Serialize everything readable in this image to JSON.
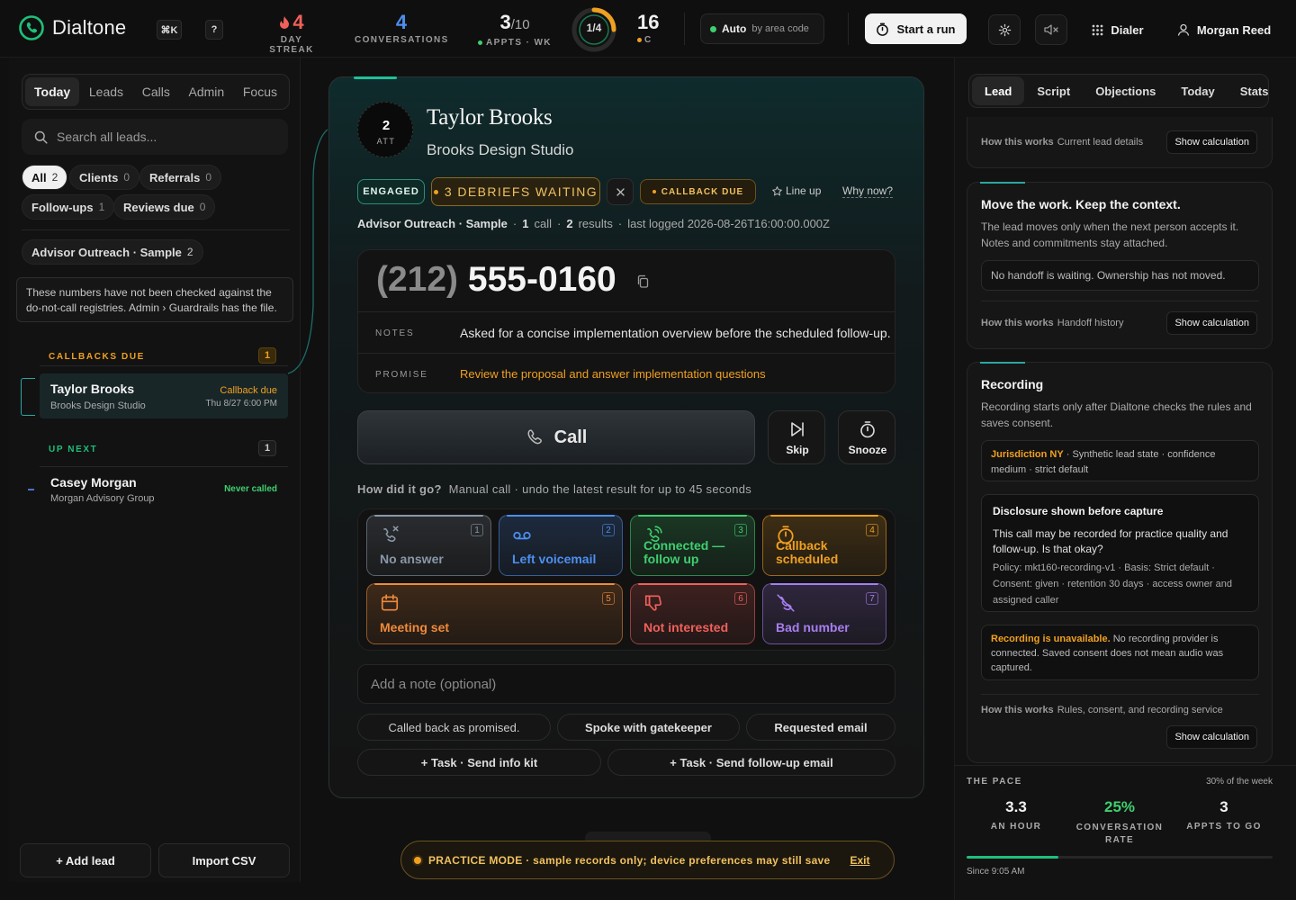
{
  "app": {
    "name": "Dialtone",
    "accent": "#1fbf7a"
  },
  "topbar": {
    "kbd_search": "⌘K",
    "kbd_help": "?",
    "streak": {
      "value": "4",
      "label": "DAY STREAK"
    },
    "conversations": {
      "value": "4",
      "label": "CONVERSATIONS"
    },
    "appts": {
      "value": "3",
      "total": "/10",
      "label": "APPTS · WK"
    },
    "ring": {
      "label": "1/4",
      "fraction": 0.25
    },
    "extra": {
      "value": "16",
      "label": "C"
    },
    "auto": {
      "label": "Auto",
      "sub": "by area code"
    },
    "start_run": "Start a run",
    "dialer": "Dialer",
    "user": "Morgan Reed"
  },
  "left": {
    "tabs": [
      "Today",
      "Leads",
      "Calls",
      "Admin",
      "Focus"
    ],
    "search_placeholder": "Search all leads...",
    "filters": [
      {
        "label": "All",
        "count": "2"
      },
      {
        "label": "Clients",
        "count": "0"
      },
      {
        "label": "Referrals",
        "count": "0"
      },
      {
        "label": "Follow-ups",
        "count": "1"
      },
      {
        "label": "Reviews due",
        "count": "0"
      }
    ],
    "campaign": {
      "label": "Advisor Outreach · Sample",
      "count": "2"
    },
    "warning": "These numbers have not been checked against the do-not-call registries. Admin › Guardrails has the file.",
    "callbacks": {
      "title": "CALLBACKS DUE",
      "count": "1",
      "item": {
        "name": "Taylor Brooks",
        "company": "Brooks Design Studio",
        "status": "Callback due",
        "time": "Thu 8/27 6:00 PM"
      }
    },
    "upnext": {
      "title": "UP NEXT",
      "count": "1",
      "item": {
        "name": "Casey Morgan",
        "company": "Morgan Advisory Group",
        "status": "Never called"
      }
    },
    "add_lead": "+ Add lead",
    "import_csv": "Import CSV"
  },
  "lead": {
    "attempts": "2",
    "attempts_label": "ATT",
    "name": "Taylor Brooks",
    "company": "Brooks Design Studio",
    "tag_engaged": "ENGAGED",
    "tag_debriefs": "3 DEBRIEFS WAITING",
    "tag_callback": "CALLBACK DUE",
    "line_up": "Line up",
    "why_now": "Why now?",
    "meta": {
      "campaign": "Advisor Outreach · Sample",
      "calls": "1",
      "calls_label": "call",
      "results": "2",
      "results_label": "results",
      "last": "last logged 2026-08-26T16:00:00.000Z"
    },
    "phone_area": "(212)",
    "phone_rest": "555-0160",
    "notes_label": "NOTES",
    "notes": "Asked for a concise implementation overview before the scheduled follow-up.",
    "promise_label": "PROMISE",
    "promise": "Review the proposal and answer implementation questions",
    "call_btn": "Call",
    "skip_btn": "Skip",
    "snooze_btn": "Snooze",
    "how_q": "How did it go?",
    "how_sub": "Manual call · undo the latest result for up to 45 seconds",
    "outcomes": [
      {
        "label": "No answer",
        "key": "1",
        "color": "#8a97a8"
      },
      {
        "label": "Left voicemail",
        "key": "2",
        "color": "#4c8ff0"
      },
      {
        "label": "Connected — follow up",
        "key": "3",
        "color": "#3fcf6f"
      },
      {
        "label": "Callback scheduled",
        "key": "4",
        "color": "#f0a020"
      },
      {
        "label": "Meeting set",
        "key": "5",
        "color": "#f08a3a"
      },
      {
        "label": "Not interested",
        "key": "6",
        "color": "#f0605a"
      },
      {
        "label": "Bad number",
        "key": "7",
        "color": "#a77ef0"
      }
    ],
    "note_placeholder": "Add a note (optional)",
    "quick": [
      "Called back as promised.",
      "Spoke with gatekeeper",
      "Requested email"
    ],
    "tasks": [
      "+ Task · Send info kit",
      "+ Task · Send follow-up email"
    ]
  },
  "practice": {
    "text": "PRACTICE MODE · sample records only; device preferences may still save",
    "exit": "Exit"
  },
  "right": {
    "tabs": [
      "Lead",
      "Script",
      "Objections",
      "Today",
      "Stats"
    ],
    "card0": {
      "hiw": "How this works",
      "hiw_sub": "Current lead details",
      "btn": "Show calculation"
    },
    "handoff": {
      "title": "Move the work. Keep the context.",
      "body": "The lead moves only when the next person accepts it. Notes and commitments stay attached.",
      "status": "No handoff is waiting. Ownership has not moved.",
      "hiw": "How this works",
      "hiw_sub": "Handoff history",
      "btn": "Show calculation"
    },
    "recording": {
      "title": "Recording",
      "body": "Recording starts only after Dialtone checks the rules and saves consent.",
      "jur_label": "Jurisdiction NY",
      "jur_text": "· Synthetic lead state · confidence medium · strict default",
      "disc_title": "Disclosure shown before capture",
      "disc_body": "This call may be recorded for practice quality and follow-up. Is that okay?",
      "disc_meta": "Policy: mkt160-recording-v1 · Basis: Strict default · Consent: given · retention 30 days · access owner and assigned caller",
      "unavail_label": "Recording is unavailable.",
      "unavail_text": "No recording provider is connected. Saved consent does not mean audio was captured.",
      "hiw": "How this works",
      "hiw_sub": "Rules, consent, and recording service",
      "btn": "Show calculation"
    },
    "pace": {
      "title": "THE PACE",
      "sub": "30% of the week",
      "progress": 0.3,
      "stats": [
        {
          "value": "3.3",
          "label": "AN HOUR"
        },
        {
          "value": "25%",
          "label": "CONVERSATION RATE"
        },
        {
          "value": "3",
          "label": "APPTS TO GO"
        }
      ],
      "since": "Since 9:05 AM"
    }
  }
}
